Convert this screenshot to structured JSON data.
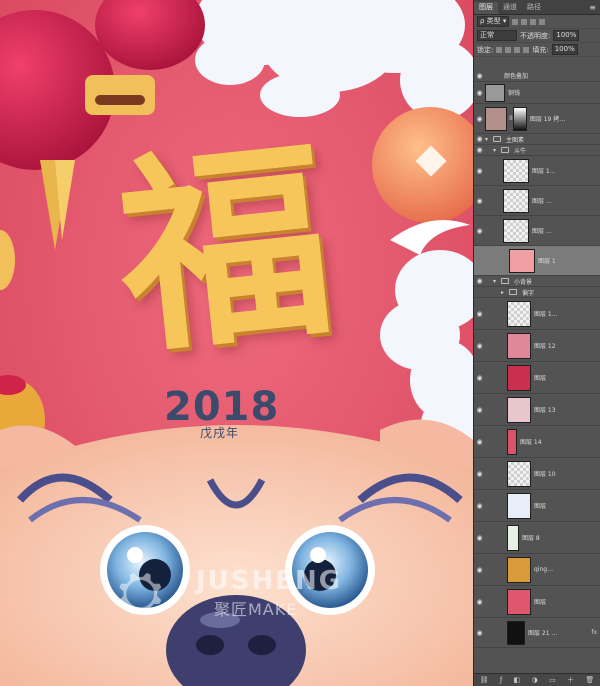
{
  "artwork": {
    "fu_char": "福",
    "year": "2018",
    "year_sub": "戊戌年",
    "watermark_brand": "JUSHENG",
    "watermark_sub": "聚匠MAKE",
    "colors": {
      "background": "#e9586e",
      "cloud": "#f2f5fb",
      "gold": "#f7c65a",
      "lantern": "#d0234a",
      "coin": "#f08a5d",
      "dog": "#f7c6ae",
      "text_dark": "#3c4a6b"
    }
  },
  "panel": {
    "tabs": [
      "图层",
      "通道",
      "路径"
    ],
    "filter_label": "类型",
    "blend_mode": "正常",
    "opacity_label": "不透明度:",
    "opacity_value": "100%",
    "lock_label": "锁定:",
    "fill_label": "填充:",
    "fill_value": "100%",
    "layers": [
      {
        "name": "颜色叠加",
        "type": "effect"
      },
      {
        "name": "铜钱",
        "type": "layer"
      },
      {
        "name": "图层 19 拷…",
        "type": "masked"
      },
      {
        "name": "主图素",
        "type": "group"
      },
      {
        "name": "斗牛",
        "type": "group"
      },
      {
        "name": "图层 1…",
        "type": "layer"
      },
      {
        "name": "图层 …",
        "type": "layer"
      },
      {
        "name": "图层 …",
        "type": "layer"
      },
      {
        "name": "图层 1",
        "type": "layer",
        "selected": true
      },
      {
        "name": "小背景",
        "type": "group"
      },
      {
        "name": "偏字",
        "type": "group"
      },
      {
        "name": "图层 1…",
        "type": "layer"
      },
      {
        "name": "图层 12",
        "type": "layer"
      },
      {
        "name": "图层",
        "type": "layer"
      },
      {
        "name": "图层 13",
        "type": "layer"
      },
      {
        "name": "图层 14",
        "type": "layer"
      },
      {
        "name": "图层 10",
        "type": "layer"
      },
      {
        "name": "图层",
        "type": "layer"
      },
      {
        "name": "图层 8",
        "type": "layer"
      },
      {
        "name": "qing…",
        "type": "layer"
      },
      {
        "name": "图层",
        "type": "layer"
      },
      {
        "name": "图层 21 …",
        "type": "layer"
      }
    ],
    "bottom_icons": [
      "link-icon",
      "fx-icon",
      "mask-icon",
      "adjustment-icon",
      "folder-icon",
      "new-layer-icon",
      "trash-icon"
    ],
    "bottom_fx": "fx"
  }
}
